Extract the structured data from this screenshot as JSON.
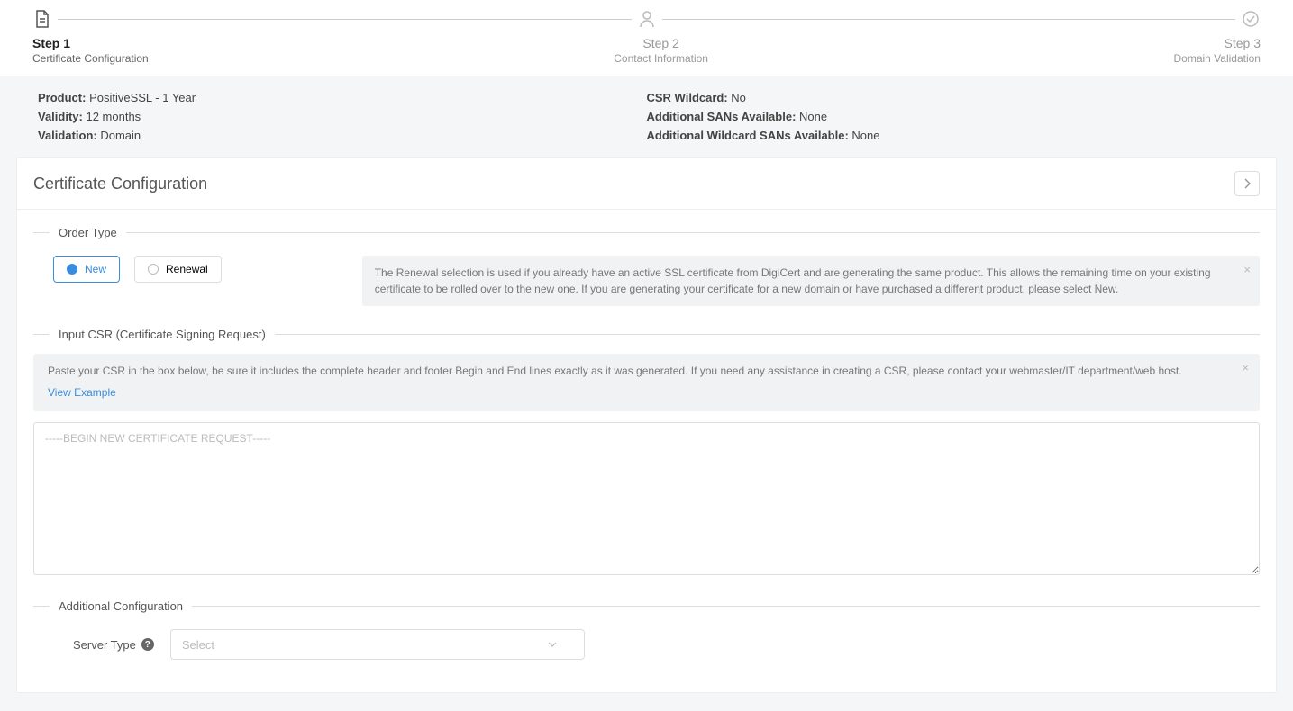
{
  "stepper": {
    "step1": {
      "title": "Step 1",
      "sub": "Certificate Configuration"
    },
    "step2": {
      "title": "Step 2",
      "sub": "Contact Information"
    },
    "step3": {
      "title": "Step 3",
      "sub": "Domain Validation"
    }
  },
  "summary": {
    "left": {
      "product_label": "Product:",
      "product_value": " PositiveSSL - 1 Year",
      "validity_label": "Validity:",
      "validity_value": " 12 months",
      "validation_label": "Validation:",
      "validation_value": " Domain"
    },
    "right": {
      "wildcard_label": "CSR Wildcard:",
      "wildcard_value": " No",
      "sans_label": "Additional SANs Available:",
      "sans_value": " None",
      "wild_sans_label": "Additional Wildcard SANs Available:",
      "wild_sans_value": " None"
    }
  },
  "section": {
    "title": "Certificate Configuration"
  },
  "order_type": {
    "legend": "Order Type",
    "new_label": "New",
    "renewal_label": "Renewal",
    "info": "The Renewal selection is used if you already have an active SSL certificate from DigiCert and are generating the same product. This allows the remaining time on your existing certificate to be rolled over to the new one. If you are generating your certificate for a new domain or have purchased a different product, please select New."
  },
  "csr": {
    "legend": "Input CSR (Certificate Signing Request)",
    "help": "Paste your CSR in the box below, be sure it includes the complete header and footer Begin and End lines exactly as it was generated. If you need any assistance in creating a CSR, please contact your webmaster/IT department/web host.",
    "example_link": "View Example",
    "placeholder": "-----BEGIN NEW CERTIFICATE REQUEST-----"
  },
  "additional": {
    "legend": "Additional Configuration",
    "server_type_label": "Server Type",
    "select_placeholder": "Select"
  }
}
